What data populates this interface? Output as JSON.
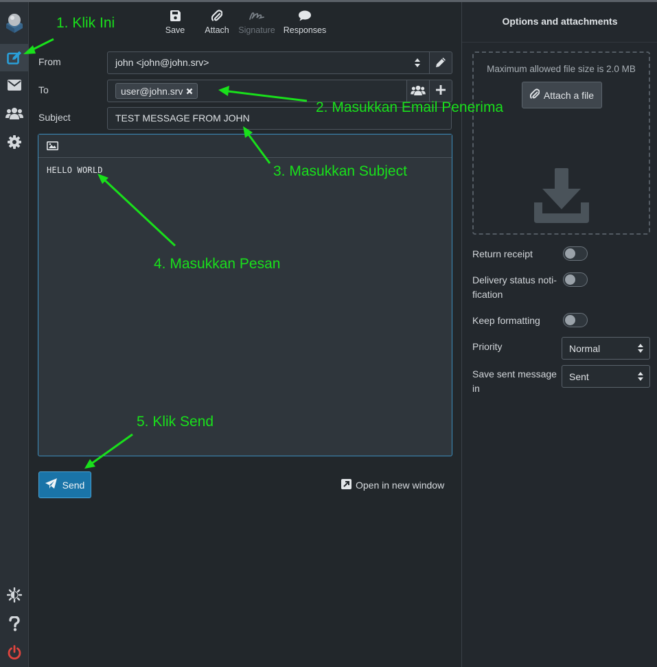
{
  "toolbar": {
    "save_label": "Save",
    "attach_label": "Attach",
    "signature_label": "Signature",
    "responses_label": "Responses"
  },
  "form": {
    "from_label": "From",
    "from_value": "john <john@john.srv>",
    "to_label": "To",
    "to_recipients": [
      "user@john.srv"
    ],
    "subject_label": "Subject",
    "subject_value": "TEST MESSAGE FROM JOHN",
    "body_text": "HELLO WORLD",
    "send_label": "Send",
    "open_new_window_label": "Open in new window"
  },
  "panel": {
    "title": "Options and attachments",
    "max_file_size": "Maximum allowed file size is 2.0 MB",
    "attach_file_label": "Attach a file",
    "return_receipt_label": "Return receipt",
    "return_receipt_on": false,
    "delivery_status_label_1": "Delivery status noti-",
    "delivery_status_label_2": "fication",
    "delivery_status_on": false,
    "keep_formatting_label": "Keep formatting",
    "keep_formatting_on": false,
    "priority_label": "Priority",
    "priority_value": "Normal",
    "save_sent_label_1": "Save sent message",
    "save_sent_label_2": "in",
    "save_sent_value": "Sent"
  },
  "annotations": {
    "step1": "1. Klik Ini",
    "step2": "2. Masukkan Email Penerima",
    "step3": "3. Masukkan Subject",
    "step4": "4. Masukkan Pesan",
    "step5": "5. Klik Send"
  },
  "colors": {
    "background": "#22272b",
    "accent": "#1a74a8",
    "annotation": "#19e01b",
    "logout": "#e0443e"
  },
  "icons": {
    "nav": [
      "compose-icon",
      "mail-icon",
      "contacts-icon",
      "settings-icon"
    ],
    "bottom": [
      "theme-icon",
      "help-icon",
      "logout-icon"
    ]
  }
}
